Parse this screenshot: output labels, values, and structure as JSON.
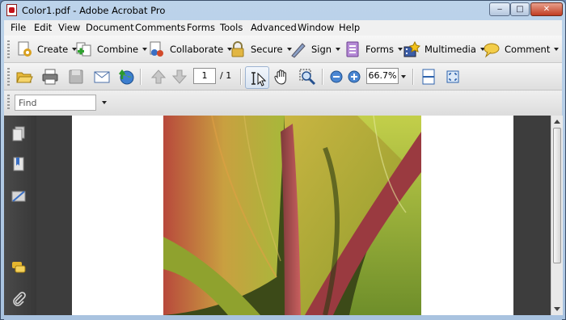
{
  "window": {
    "title": "Color1.pdf - Adobe Acrobat Pro",
    "controls": {
      "minimize": "‒",
      "maximize": "□",
      "close": "✕"
    }
  },
  "menu": [
    "File",
    "Edit",
    "View",
    "Document",
    "Comments",
    "Forms",
    "Tools",
    "Advanced",
    "Window",
    "Help"
  ],
  "toolbar_tasks": [
    {
      "label": "Create",
      "icon": "create-pdf-icon"
    },
    {
      "label": "Combine",
      "icon": "combine-files-icon"
    },
    {
      "label": "Collaborate",
      "icon": "collaborate-icon"
    },
    {
      "label": "Secure",
      "icon": "lock-icon"
    },
    {
      "label": "Sign",
      "icon": "pen-sign-icon"
    },
    {
      "label": "Forms",
      "icon": "forms-icon"
    },
    {
      "label": "Multimedia",
      "icon": "multimedia-icon"
    },
    {
      "label": "Comment",
      "icon": "comment-bubble-icon"
    }
  ],
  "toolbar_nav": {
    "page_current": "1",
    "page_total": "/ 1",
    "zoom": "66.7%"
  },
  "find": {
    "placeholder": "Find"
  },
  "colors": {
    "title_bg": "#a9c3e0",
    "toolbar_bg": "#e8e8e8",
    "panel_bg": "#3d3d3d",
    "accent_red": "#c4121a"
  }
}
